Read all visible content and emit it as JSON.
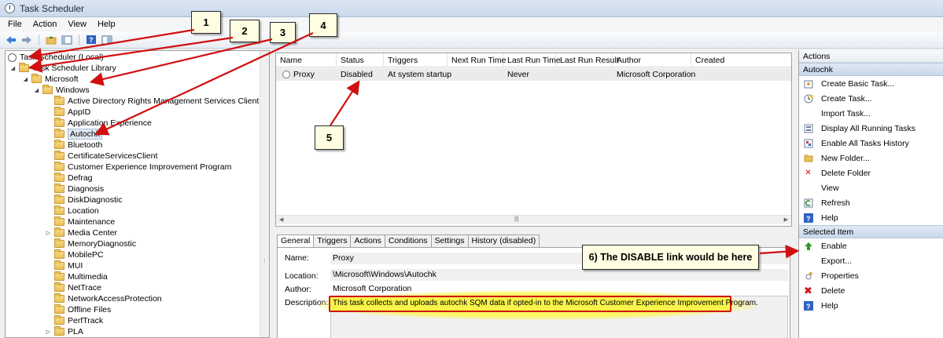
{
  "window": {
    "title": "Task Scheduler"
  },
  "menu": [
    "File",
    "Action",
    "View",
    "Help"
  ],
  "tree": {
    "root": "Task Scheduler (Local)",
    "library": "Task Scheduler Library",
    "microsoft": "Microsoft",
    "windows": "Windows",
    "folders": [
      "Active Directory Rights Management Services Client",
      "AppID",
      "Application Experience",
      "Autochk",
      "Bluetooth",
      "CertificateServicesClient",
      "Customer Experience Improvement Program",
      "Defrag",
      "Diagnosis",
      "DiskDiagnostic",
      "Location",
      "Maintenance",
      "Media Center",
      "MemoryDiagnostic",
      "MobilePC",
      "MUI",
      "Multimedia",
      "NetTrace",
      "NetworkAccessProtection",
      "Offline Files",
      "PerfTrack",
      "PLA"
    ]
  },
  "tasklist": {
    "columns": [
      "Name",
      "Status",
      "Triggers",
      "Next Run Time",
      "Last Run Time",
      "Last Run Result",
      "Author",
      "Created"
    ],
    "row": {
      "name": "Proxy",
      "status": "Disabled",
      "triggers": "At system startup",
      "next_run": "",
      "last_run": "Never",
      "last_result": "",
      "author": "Microsoft Corporation",
      "created": ""
    }
  },
  "detail": {
    "tabs": [
      "General",
      "Triggers",
      "Actions",
      "Conditions",
      "Settings",
      "History (disabled)"
    ],
    "name_label": "Name:",
    "name_value": "Proxy",
    "location_label": "Location:",
    "location_value": "\\Microsoft\\Windows\\Autochk",
    "author_label": "Author:",
    "author_value": "Microsoft Corporation",
    "description_label": "Description:",
    "description_value": "This task collects and uploads autochk SQM data if opted-in to the Microsoft Customer Experience Improvement Program."
  },
  "actions": {
    "title": "Actions",
    "section1": "Autochk",
    "items1": [
      "Create Basic Task...",
      "Create Task...",
      "Import Task...",
      "Display All Running Tasks",
      "Enable All Tasks History",
      "New Folder...",
      "Delete Folder",
      "View",
      "Refresh",
      "Help"
    ],
    "section2": "Selected Item",
    "items2": [
      "Enable",
      "Export...",
      "Properties",
      "Delete",
      "Help"
    ]
  },
  "annotations": {
    "c1": "1",
    "c2": "2",
    "c3": "3",
    "c4": "4",
    "c5": "5",
    "c6": "6) The DISABLE link would be here"
  },
  "colors": {
    "arrow": "#d01010",
    "highlight": "#f7f54a",
    "callout_bg": "#fffde2"
  }
}
